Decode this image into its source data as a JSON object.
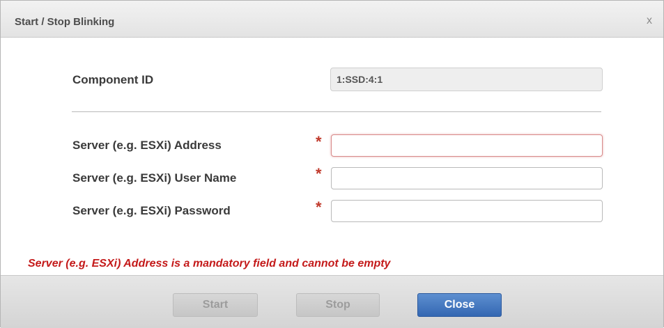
{
  "dialog": {
    "title": "Start / Stop Blinking",
    "close_glyph": "x"
  },
  "component": {
    "label": "Component ID",
    "value": "1:SSD:4:1"
  },
  "fields": [
    {
      "label": "Server (e.g. ESXi) Address",
      "value": "",
      "required_marker": "*",
      "state": "invalid-focused"
    },
    {
      "label": "Server (e.g. ESXi) User Name",
      "value": "",
      "required_marker": "*"
    },
    {
      "label": "Server (e.g. ESXi) Password",
      "value": "",
      "required_marker": "*"
    }
  ],
  "error": {
    "message": "Server (e.g. ESXi) Address is a mandatory field and cannot be empty",
    "color": "#c41a1a"
  },
  "buttons": {
    "start_label": "Start",
    "stop_label": "Stop",
    "close_label": "Close"
  },
  "colors": {
    "primary_button": "#3f74bd",
    "required_asterisk": "#c0392b"
  }
}
